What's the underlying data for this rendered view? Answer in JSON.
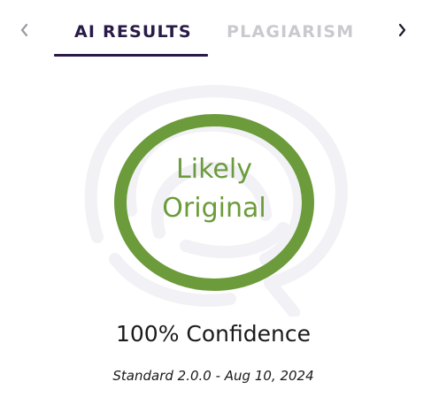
{
  "tabs": {
    "ai_results_label": "AI RESULTS",
    "plagiarism_label": "PLAGIARISM",
    "active": "AI RESULTS",
    "prev_icon": "chevron-left-icon",
    "next_icon": "chevron-right-icon"
  },
  "result": {
    "line1": "Likely",
    "line2": "Original",
    "confidence_text": "100% Confidence",
    "model_version_text": "Standard 2.0.0 - Aug 10, 2024",
    "ring_color": "#6b9b3a"
  },
  "colors": {
    "active_tab": "#2a1a47",
    "inactive_tab": "#c9c9cf",
    "watermark": "#f1f1f6"
  }
}
